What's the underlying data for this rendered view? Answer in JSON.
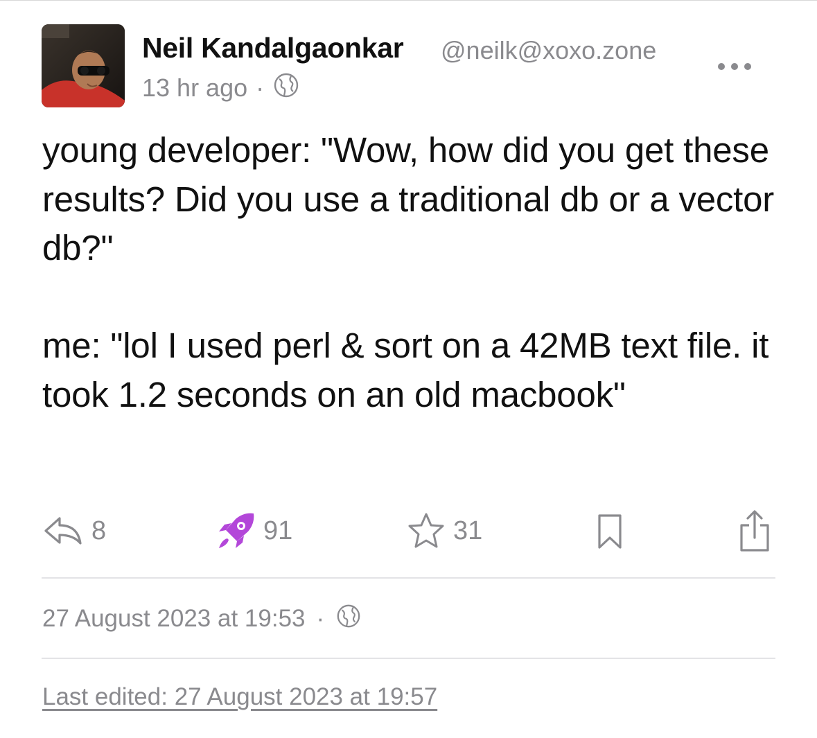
{
  "author": {
    "display_name": "Neil Kandalgaonkar",
    "handle": "@neilk@xoxo.zone",
    "avatar_icon": "profile-photo"
  },
  "post": {
    "relative_time": "13 hr ago",
    "separator": "·",
    "visibility_icon": "globe-icon",
    "paragraphs": [
      "young developer: \"Wow, how did you get these results? Did you use a traditional db or a vector db?\"",
      "me: \"lol I used perl & sort on a 42MB text file. it took 1.2 seconds on an old macbook\""
    ]
  },
  "actions": {
    "reply": {
      "icon": "reply-icon",
      "count": "8"
    },
    "boost": {
      "icon": "rocket-icon",
      "count": "91",
      "color": "#b347d9"
    },
    "favourite": {
      "icon": "star-icon",
      "count": "31"
    },
    "bookmark": {
      "icon": "bookmark-icon"
    },
    "share": {
      "icon": "share-icon"
    }
  },
  "details": {
    "timestamp": "27 August 2023 at 19:53",
    "separator": "·",
    "edited": "Last edited: 27 August 2023 at 19:57"
  },
  "colors": {
    "text": "#111111",
    "muted": "#8a8a8e",
    "boost_accent": "#b347d9",
    "divider": "#e3e3e6"
  }
}
